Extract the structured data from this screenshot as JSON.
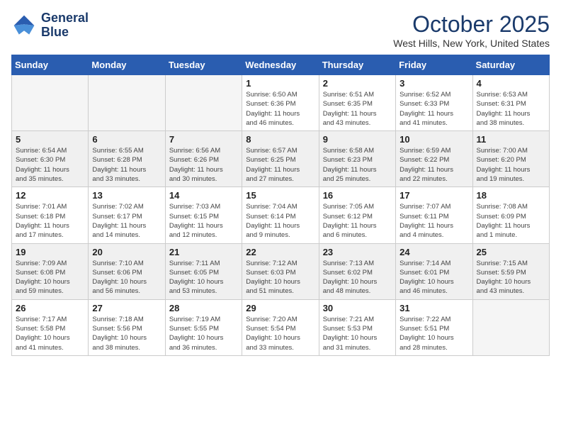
{
  "header": {
    "logo_line1": "General",
    "logo_line2": "Blue",
    "month": "October 2025",
    "location": "West Hills, New York, United States"
  },
  "weekdays": [
    "Sunday",
    "Monday",
    "Tuesday",
    "Wednesday",
    "Thursday",
    "Friday",
    "Saturday"
  ],
  "weeks": [
    [
      {
        "day": "",
        "info": ""
      },
      {
        "day": "",
        "info": ""
      },
      {
        "day": "",
        "info": ""
      },
      {
        "day": "1",
        "info": "Sunrise: 6:50 AM\nSunset: 6:36 PM\nDaylight: 11 hours\nand 46 minutes."
      },
      {
        "day": "2",
        "info": "Sunrise: 6:51 AM\nSunset: 6:35 PM\nDaylight: 11 hours\nand 43 minutes."
      },
      {
        "day": "3",
        "info": "Sunrise: 6:52 AM\nSunset: 6:33 PM\nDaylight: 11 hours\nand 41 minutes."
      },
      {
        "day": "4",
        "info": "Sunrise: 6:53 AM\nSunset: 6:31 PM\nDaylight: 11 hours\nand 38 minutes."
      }
    ],
    [
      {
        "day": "5",
        "info": "Sunrise: 6:54 AM\nSunset: 6:30 PM\nDaylight: 11 hours\nand 35 minutes."
      },
      {
        "day": "6",
        "info": "Sunrise: 6:55 AM\nSunset: 6:28 PM\nDaylight: 11 hours\nand 33 minutes."
      },
      {
        "day": "7",
        "info": "Sunrise: 6:56 AM\nSunset: 6:26 PM\nDaylight: 11 hours\nand 30 minutes."
      },
      {
        "day": "8",
        "info": "Sunrise: 6:57 AM\nSunset: 6:25 PM\nDaylight: 11 hours\nand 27 minutes."
      },
      {
        "day": "9",
        "info": "Sunrise: 6:58 AM\nSunset: 6:23 PM\nDaylight: 11 hours\nand 25 minutes."
      },
      {
        "day": "10",
        "info": "Sunrise: 6:59 AM\nSunset: 6:22 PM\nDaylight: 11 hours\nand 22 minutes."
      },
      {
        "day": "11",
        "info": "Sunrise: 7:00 AM\nSunset: 6:20 PM\nDaylight: 11 hours\nand 19 minutes."
      }
    ],
    [
      {
        "day": "12",
        "info": "Sunrise: 7:01 AM\nSunset: 6:18 PM\nDaylight: 11 hours\nand 17 minutes."
      },
      {
        "day": "13",
        "info": "Sunrise: 7:02 AM\nSunset: 6:17 PM\nDaylight: 11 hours\nand 14 minutes."
      },
      {
        "day": "14",
        "info": "Sunrise: 7:03 AM\nSunset: 6:15 PM\nDaylight: 11 hours\nand 12 minutes."
      },
      {
        "day": "15",
        "info": "Sunrise: 7:04 AM\nSunset: 6:14 PM\nDaylight: 11 hours\nand 9 minutes."
      },
      {
        "day": "16",
        "info": "Sunrise: 7:05 AM\nSunset: 6:12 PM\nDaylight: 11 hours\nand 6 minutes."
      },
      {
        "day": "17",
        "info": "Sunrise: 7:07 AM\nSunset: 6:11 PM\nDaylight: 11 hours\nand 4 minutes."
      },
      {
        "day": "18",
        "info": "Sunrise: 7:08 AM\nSunset: 6:09 PM\nDaylight: 11 hours\nand 1 minute."
      }
    ],
    [
      {
        "day": "19",
        "info": "Sunrise: 7:09 AM\nSunset: 6:08 PM\nDaylight: 10 hours\nand 59 minutes."
      },
      {
        "day": "20",
        "info": "Sunrise: 7:10 AM\nSunset: 6:06 PM\nDaylight: 10 hours\nand 56 minutes."
      },
      {
        "day": "21",
        "info": "Sunrise: 7:11 AM\nSunset: 6:05 PM\nDaylight: 10 hours\nand 53 minutes."
      },
      {
        "day": "22",
        "info": "Sunrise: 7:12 AM\nSunset: 6:03 PM\nDaylight: 10 hours\nand 51 minutes."
      },
      {
        "day": "23",
        "info": "Sunrise: 7:13 AM\nSunset: 6:02 PM\nDaylight: 10 hours\nand 48 minutes."
      },
      {
        "day": "24",
        "info": "Sunrise: 7:14 AM\nSunset: 6:01 PM\nDaylight: 10 hours\nand 46 minutes."
      },
      {
        "day": "25",
        "info": "Sunrise: 7:15 AM\nSunset: 5:59 PM\nDaylight: 10 hours\nand 43 minutes."
      }
    ],
    [
      {
        "day": "26",
        "info": "Sunrise: 7:17 AM\nSunset: 5:58 PM\nDaylight: 10 hours\nand 41 minutes."
      },
      {
        "day": "27",
        "info": "Sunrise: 7:18 AM\nSunset: 5:56 PM\nDaylight: 10 hours\nand 38 minutes."
      },
      {
        "day": "28",
        "info": "Sunrise: 7:19 AM\nSunset: 5:55 PM\nDaylight: 10 hours\nand 36 minutes."
      },
      {
        "day": "29",
        "info": "Sunrise: 7:20 AM\nSunset: 5:54 PM\nDaylight: 10 hours\nand 33 minutes."
      },
      {
        "day": "30",
        "info": "Sunrise: 7:21 AM\nSunset: 5:53 PM\nDaylight: 10 hours\nand 31 minutes."
      },
      {
        "day": "31",
        "info": "Sunrise: 7:22 AM\nSunset: 5:51 PM\nDaylight: 10 hours\nand 28 minutes."
      },
      {
        "day": "",
        "info": ""
      }
    ]
  ]
}
